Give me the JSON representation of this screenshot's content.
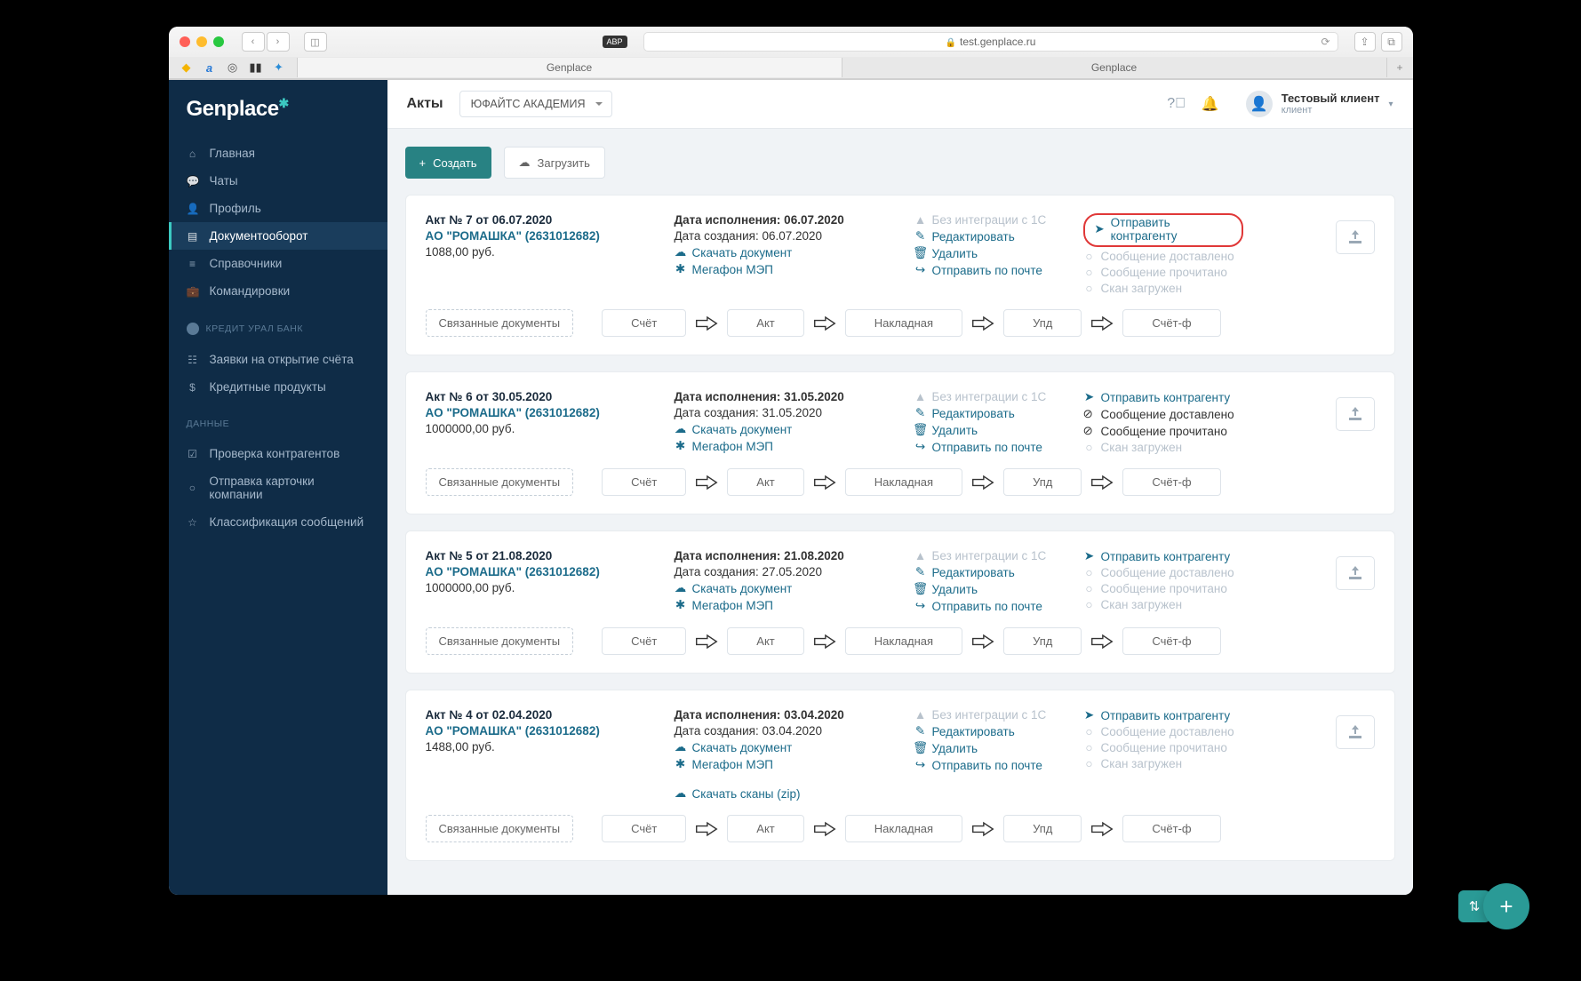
{
  "browser": {
    "url": "test.genplace.ru",
    "tabs": [
      "Genplace",
      "Genplace"
    ]
  },
  "logo": "Genplace",
  "sidebar": {
    "main": [
      {
        "icon": "home",
        "label": "Главная"
      },
      {
        "icon": "chat",
        "label": "Чаты"
      },
      {
        "icon": "user",
        "label": "Профиль"
      },
      {
        "icon": "doc",
        "label": "Документооборот"
      },
      {
        "icon": "db",
        "label": "Справочники"
      },
      {
        "icon": "case",
        "label": "Командировки"
      }
    ],
    "bank_section": "КРЕДИТ УРАЛ БАНК",
    "bank": [
      {
        "icon": "list",
        "label": "Заявки на открытие счёта"
      },
      {
        "icon": "money",
        "label": "Кредитные продукты"
      }
    ],
    "data_section": "ДАННЫЕ",
    "data": [
      {
        "icon": "check",
        "label": "Проверка контрагентов"
      },
      {
        "icon": "send",
        "label": "Отправка карточки компании"
      },
      {
        "icon": "star",
        "label": "Классификация сообщений"
      }
    ]
  },
  "header": {
    "title": "Акты",
    "org": "ЮФАЙТС АКАДЕМИЯ",
    "user_name": "Тестовый клиент",
    "user_sub": "клиент"
  },
  "actions": {
    "create": "Создать",
    "upload": "Загрузить"
  },
  "labels": {
    "no_integration": "Без интеграции с 1С",
    "edit": "Редактировать",
    "delete": "Удалить",
    "send_mail": "Отправить по почте",
    "send_counterparty": "Отправить контрагенту",
    "msg_delivered": "Сообщение доставлено",
    "msg_read": "Сообщение прочитано",
    "scan_uploaded": "Скан загружен",
    "download_doc": "Скачать документ",
    "megafon": "Мегафон МЭП",
    "download_scans": "Скачать сканы (zip)",
    "date_exec": "Дата исполнения:",
    "date_created": "Дата создания:",
    "related": "Связанные документы",
    "flow": [
      "Счёт",
      "Акт",
      "Накладная",
      "Упд",
      "Счёт-ф"
    ]
  },
  "cards": [
    {
      "title": "Акт № 7 от 06.07.2020",
      "company": "АО \"РОМАШКА\" (2631012682)",
      "price": "1088,00 руб.",
      "exec": "06.07.2020",
      "created": "06.07.2020",
      "highlighted": true,
      "delivered": false,
      "read": false,
      "scan": false,
      "scans_zip": false
    },
    {
      "title": "Акт № 6 от 30.05.2020",
      "company": "АО \"РОМАШКА\" (2631012682)",
      "price": "1000000,00 руб.",
      "exec": "31.05.2020",
      "created": "31.05.2020",
      "highlighted": false,
      "delivered": true,
      "read": true,
      "scan": false,
      "scans_zip": false
    },
    {
      "title": "Акт № 5 от 21.08.2020",
      "company": "АО \"РОМАШКА\" (2631012682)",
      "price": "1000000,00 руб.",
      "exec": "21.08.2020",
      "created": "27.05.2020",
      "highlighted": false,
      "delivered": false,
      "read": false,
      "scan": false,
      "scans_zip": false
    },
    {
      "title": "Акт № 4 от 02.04.2020",
      "company": "АО \"РОМАШКА\" (2631012682)",
      "price": "1488,00 руб.",
      "exec": "03.04.2020",
      "created": "03.04.2020",
      "highlighted": false,
      "delivered": false,
      "read": false,
      "scan": false,
      "scans_zip": true
    }
  ]
}
